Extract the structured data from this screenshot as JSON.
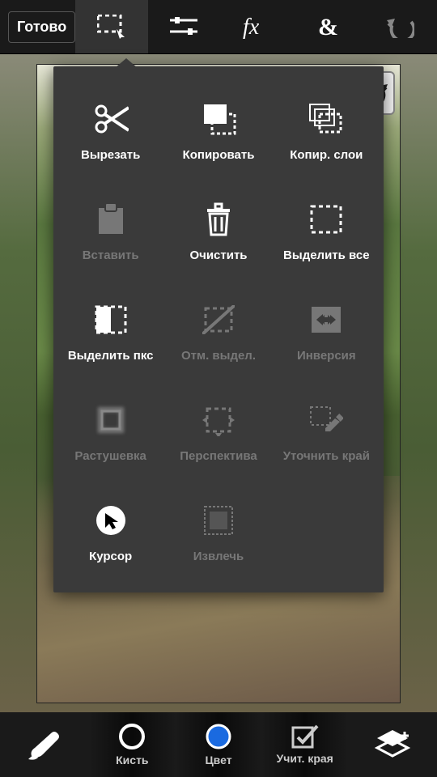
{
  "toolbar": {
    "done": "Готово"
  },
  "menu": {
    "cut": "Вырезать",
    "copy": "Копировать",
    "copy_layers": "Копир. слои",
    "paste": "Вставить",
    "clear": "Очистить",
    "select_all": "Выделить все",
    "select_px": "Выделить пкс",
    "deselect": "Отм. выдел.",
    "inverse": "Инверсия",
    "feather": "Растушевка",
    "perspective": "Перспектива",
    "refine_edge": "Уточнить край",
    "cursor": "Курсор",
    "extract": "Извлечь"
  },
  "bottom": {
    "brush": "Кисть",
    "color": "Цвет",
    "edges": "Учит. края"
  }
}
